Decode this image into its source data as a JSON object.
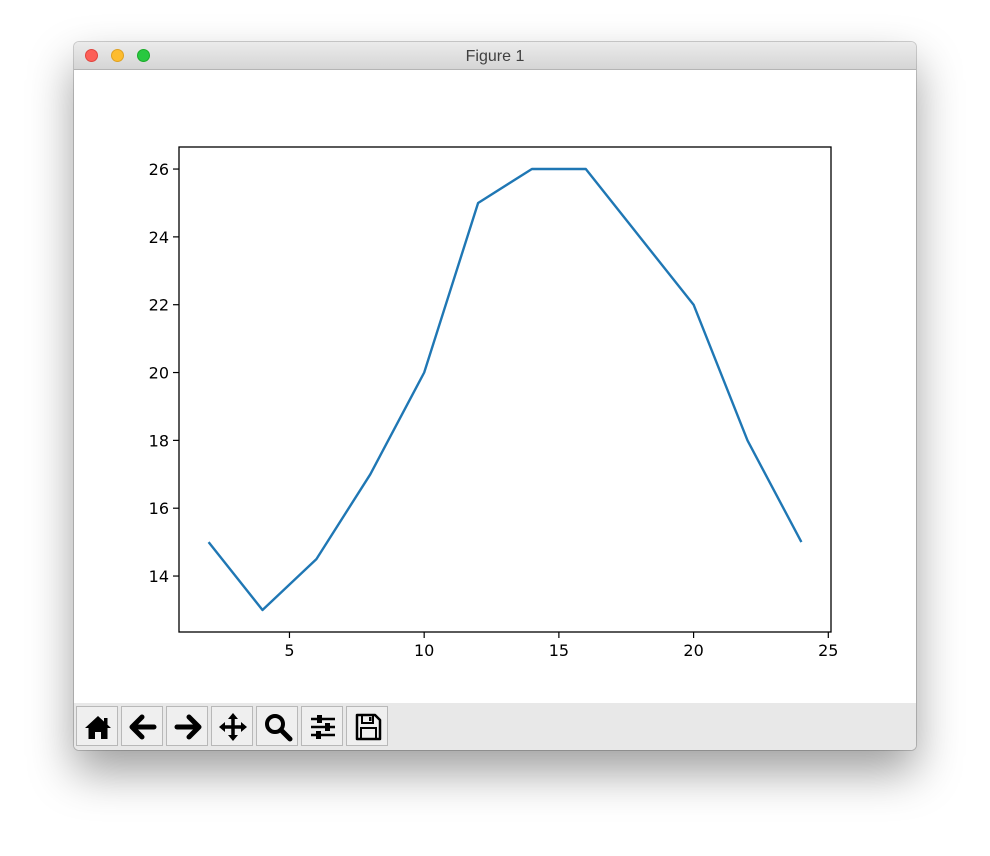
{
  "window": {
    "title": "Figure 1"
  },
  "toolbar": {
    "buttons": [
      {
        "name": "home-button",
        "icon": "home-icon"
      },
      {
        "name": "back-button",
        "icon": "arrow-left-icon"
      },
      {
        "name": "forward-button",
        "icon": "arrow-right-icon"
      },
      {
        "name": "pan-button",
        "icon": "move-icon"
      },
      {
        "name": "zoom-button",
        "icon": "search-icon"
      },
      {
        "name": "configure-subplots-button",
        "icon": "sliders-icon"
      },
      {
        "name": "save-button",
        "icon": "floppy-disk-icon"
      }
    ]
  },
  "chart_data": {
    "type": "line",
    "x": [
      2,
      4,
      6,
      8,
      10,
      12,
      14,
      16,
      18,
      20,
      22,
      24
    ],
    "series": [
      {
        "values": [
          15,
          13,
          14.5,
          17,
          20,
          25,
          26,
          26,
          24,
          22,
          18,
          15
        ],
        "color": "#1f77b4"
      }
    ],
    "xticks": [
      "5",
      "10",
      "15",
      "20",
      "25"
    ],
    "yticks": [
      "14",
      "16",
      "18",
      "20",
      "22",
      "24",
      "26"
    ],
    "xlim": [
      0.9,
      25.1
    ],
    "ylim": [
      12.35,
      26.65
    ],
    "title": "",
    "xlabel": "",
    "ylabel": "",
    "grid": false,
    "legend": false
  }
}
